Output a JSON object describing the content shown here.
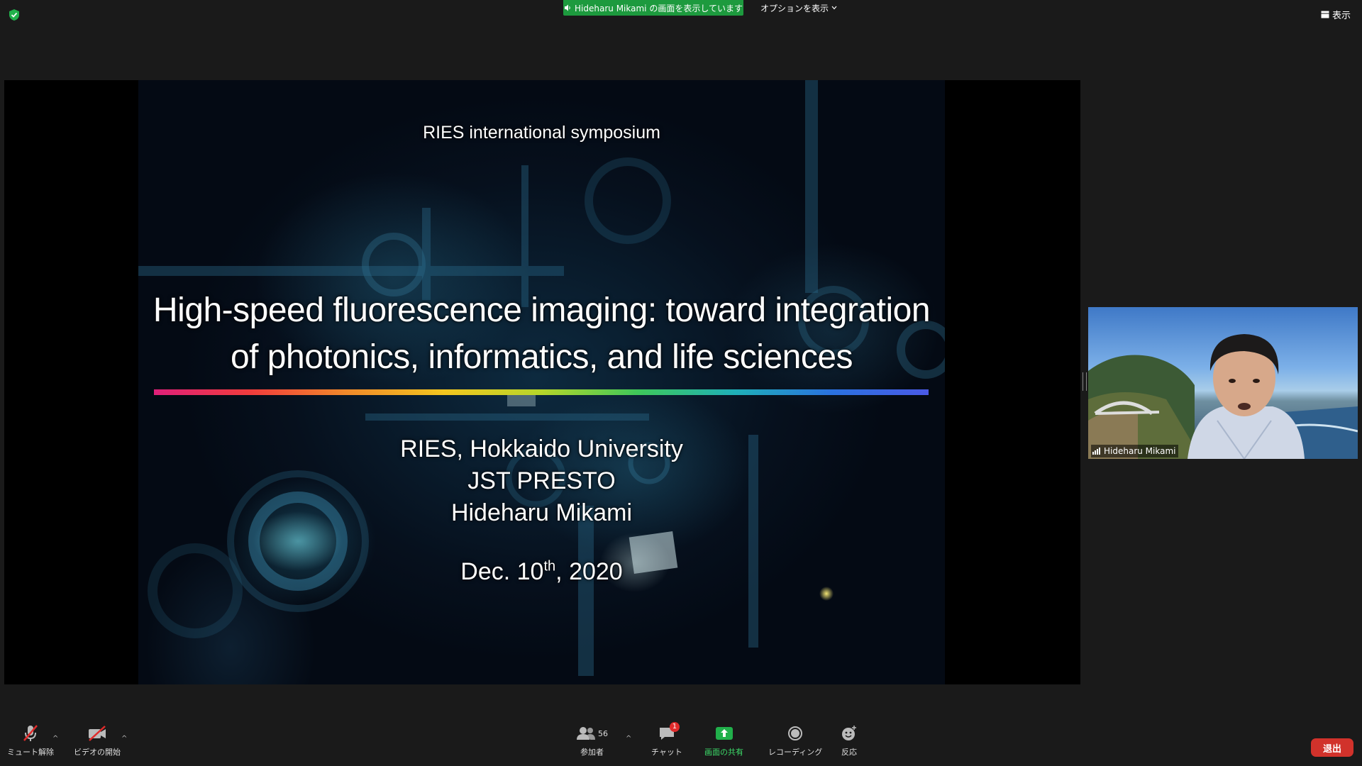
{
  "top_bar": {
    "share_status": "Hideharu  Mikami  の画面を表示しています",
    "options_label": "オプションを表示",
    "view_label": "表示"
  },
  "slide": {
    "symposium": "RIES international symposium",
    "title_line1": "High-speed fluorescence imaging: toward integration",
    "title_line2": "of photonics, informatics, and life sciences",
    "affiliation1": "RIES, Hokkaido University",
    "affiliation2": "JST PRESTO",
    "presenter": "Hideharu Mikami",
    "date_prefix": "Dec. 10",
    "date_sup": "th",
    "date_suffix": ", 2020"
  },
  "video": {
    "participant_name": "Hideharu Mikami"
  },
  "toolbar": {
    "unmute": "ミュート解除",
    "start_video": "ビデオの開始",
    "participants": "参加者",
    "participants_count": "56",
    "chat": "チャット",
    "chat_badge": "1",
    "share_screen": "画面の共有",
    "recording": "レコーディング",
    "reactions": "反応",
    "leave": "退出"
  },
  "colors": {
    "share_green": "#1d9a3e",
    "leave_red": "#d1322b",
    "badge_red": "#e02b2b"
  },
  "icons": [
    "shield-icon",
    "speaker-icon",
    "chevron-down-icon",
    "view-grid-icon",
    "muted-mic-icon",
    "video-off-icon",
    "participants-icon",
    "chat-icon",
    "share-screen-icon",
    "record-icon",
    "reaction-icon",
    "signal-icon"
  ]
}
